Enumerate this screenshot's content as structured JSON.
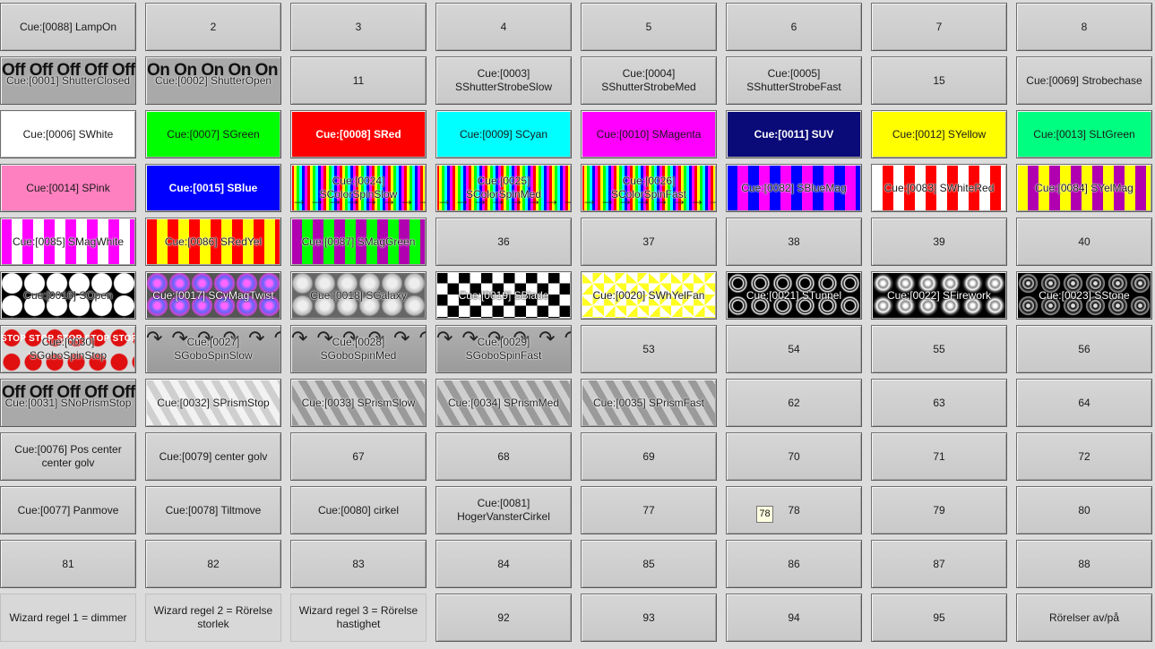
{
  "grid": {
    "rows": 12,
    "cols": 8,
    "buttons": [
      {
        "label": "Cue:[0088] LampOn",
        "style": "plain"
      },
      {
        "label": "2",
        "style": "plain"
      },
      {
        "label": "3",
        "style": "plain"
      },
      {
        "label": "4",
        "style": "plain"
      },
      {
        "label": "5",
        "style": "plain"
      },
      {
        "label": "6",
        "style": "plain"
      },
      {
        "label": "7",
        "style": "plain"
      },
      {
        "label": "8",
        "style": "plain"
      },
      {
        "label": "Cue:[0001] ShutterClosed",
        "style": "offon",
        "overlay": "Off Off Off Off Off",
        "bg": "#a9a9a9"
      },
      {
        "label": "Cue:[0002] ShutterOpen",
        "style": "offon",
        "overlay": "On On On On On",
        "bg": "#a9a9a9"
      },
      {
        "label": "11",
        "style": "plain"
      },
      {
        "label": "Cue:[0003]\nSShutterStrobeSlow",
        "style": "plain"
      },
      {
        "label": "Cue:[0004]\nSShutterStrobeMed",
        "style": "plain"
      },
      {
        "label": "Cue:[0005]\nSShutterStrobeFast",
        "style": "plain"
      },
      {
        "label": "15",
        "style": "plain"
      },
      {
        "label": "Cue:[0069] Strobechase",
        "style": "plain"
      },
      {
        "label": "Cue:[0006] SWhite",
        "style": "solid",
        "bg": "#ffffff"
      },
      {
        "label": "Cue:[0007] SGreen",
        "style": "solid",
        "bg": "#00ff00"
      },
      {
        "label": "Cue:[0008] SRed",
        "style": "solid",
        "bg": "#ff0000",
        "text": "light"
      },
      {
        "label": "Cue:[0009] SCyan",
        "style": "solid",
        "bg": "#00ffff"
      },
      {
        "label": "Cue:[0010] SMagenta",
        "style": "solid",
        "bg": "#ff00ff"
      },
      {
        "label": "Cue:[0011] SUV",
        "style": "solid",
        "bg": "#0a0a78",
        "text": "light"
      },
      {
        "label": "Cue:[0012] SYellow",
        "style": "solid",
        "bg": "#ffff00"
      },
      {
        "label": "Cue:[0013] SLtGreen",
        "style": "solid",
        "bg": "#00ff80"
      },
      {
        "label": "Cue:[0014] SPink",
        "style": "solid",
        "bg": "#ff80c0"
      },
      {
        "label": "Cue:[0015] SBlue",
        "style": "solid",
        "bg": "#0000ff",
        "text": "light"
      },
      {
        "label": "Cue:[0024] SColorSpinSlow",
        "style": "rainbow"
      },
      {
        "label": "Cue:[0025] SColorSpinMed",
        "style": "rainbow"
      },
      {
        "label": "Cue:[0026] SColorSpinFast",
        "style": "rainbow"
      },
      {
        "label": "Cue:[0082] SBlueMag",
        "style": "stripes",
        "c1": "#0000ff",
        "c2": "#ff00ff"
      },
      {
        "label": "Cue:[0083] SWhiteRed",
        "style": "stripes",
        "c1": "#ffffff",
        "c2": "#ff0000"
      },
      {
        "label": "Cue:[0084] SYelMag",
        "style": "stripes",
        "c1": "#ffff00",
        "c2": "#b000b0"
      },
      {
        "label": "Cue:[0085] SMagWhite",
        "style": "stripes",
        "c1": "#ff00ff",
        "c2": "#ffffff"
      },
      {
        "label": "Cue:[0086] SRedYel",
        "style": "stripes",
        "c1": "#ff0000",
        "c2": "#ffff00"
      },
      {
        "label": "Cue:[0087] SMagGreen",
        "style": "stripes",
        "c1": "#b000b0",
        "c2": "#00ff00"
      },
      {
        "label": "36",
        "style": "plain"
      },
      {
        "label": "37",
        "style": "plain"
      },
      {
        "label": "38",
        "style": "plain"
      },
      {
        "label": "39",
        "style": "plain"
      },
      {
        "label": "40",
        "style": "plain"
      },
      {
        "label": "Cue:[0016] SOpen",
        "style": "gobo",
        "gobo": "open"
      },
      {
        "label": "Cue:[0017] SCyMagTwist",
        "style": "gobo",
        "gobo": "twist"
      },
      {
        "label": "Cue:[0018] SGalaxy",
        "style": "gobo",
        "gobo": "galaxy"
      },
      {
        "label": "Cue:[0019] SBlade",
        "style": "gobo",
        "gobo": "blade"
      },
      {
        "label": "Cue:[0020] SWhYelFan",
        "style": "gobo",
        "gobo": "fan"
      },
      {
        "label": "Cue:[0021] STunnel",
        "style": "gobo",
        "gobo": "tunnel"
      },
      {
        "label": "Cue:[0022] SFirework",
        "style": "gobo",
        "gobo": "firework"
      },
      {
        "label": "Cue:[0023] SStone",
        "style": "gobo",
        "gobo": "stone"
      },
      {
        "label": "Cue:[0030] SGoboSpinStop",
        "style": "stop",
        "overlay": "STOP STOP STOP STOP STOP STOP"
      },
      {
        "label": "Cue:[0027] SGoboSpinSlow",
        "style": "spin"
      },
      {
        "label": "Cue:[0028] SGoboSpinMed",
        "style": "spin"
      },
      {
        "label": "Cue:[0029] SGoboSpinFast",
        "style": "spin"
      },
      {
        "label": "53",
        "style": "plain"
      },
      {
        "label": "54",
        "style": "plain"
      },
      {
        "label": "55",
        "style": "plain"
      },
      {
        "label": "56",
        "style": "plain"
      },
      {
        "label": "Cue:[0031] SNoPrismStop",
        "style": "offon",
        "overlay": "Off Off Off Off Off",
        "bg": "#a9a9a9"
      },
      {
        "label": "Cue:[0032] SPrismStop",
        "style": "prism",
        "bg": "#f2f2f2"
      },
      {
        "label": "Cue:[0033] SPrismSlow",
        "style": "prism",
        "bg": "#9a9a9a"
      },
      {
        "label": "Cue:[0034] SPrismMed",
        "style": "prism",
        "bg": "#9a9a9a"
      },
      {
        "label": "Cue:[0035] SPrismFast",
        "style": "prism",
        "bg": "#9a9a9a"
      },
      {
        "label": "62",
        "style": "plain"
      },
      {
        "label": "63",
        "style": "plain"
      },
      {
        "label": "64",
        "style": "plain"
      },
      {
        "label": "Cue:[0076] Pos center\ncenter golv",
        "style": "plain"
      },
      {
        "label": "Cue:[0079] center golv",
        "style": "plain"
      },
      {
        "label": "67",
        "style": "plain"
      },
      {
        "label": "68",
        "style": "plain"
      },
      {
        "label": "69",
        "style": "plain"
      },
      {
        "label": "70",
        "style": "plain"
      },
      {
        "label": "71",
        "style": "plain"
      },
      {
        "label": "72",
        "style": "plain"
      },
      {
        "label": "Cue:[0077] Panmove",
        "style": "plain"
      },
      {
        "label": "Cue:[0078] Tiltmove",
        "style": "plain"
      },
      {
        "label": "Cue:[0080] cirkel",
        "style": "plain"
      },
      {
        "label": "Cue:[0081]\nHogerVansterCirkel",
        "style": "plain"
      },
      {
        "label": "77",
        "style": "plain"
      },
      {
        "label": "78",
        "style": "plain"
      },
      {
        "label": "79",
        "style": "plain"
      },
      {
        "label": "80",
        "style": "plain"
      },
      {
        "label": "81",
        "style": "plain"
      },
      {
        "label": "82",
        "style": "plain"
      },
      {
        "label": "83",
        "style": "plain"
      },
      {
        "label": "84",
        "style": "plain"
      },
      {
        "label": "85",
        "style": "plain"
      },
      {
        "label": "86",
        "style": "plain"
      },
      {
        "label": "87",
        "style": "plain"
      },
      {
        "label": "88",
        "style": "plain"
      },
      {
        "label": "Wizard regel 1 = dimmer",
        "style": "flat"
      },
      {
        "label": "Wizard regel 2 = Rörelse\nstorlek",
        "style": "flat"
      },
      {
        "label": "Wizard regel 3 = Rörelse\nhastighet",
        "style": "flat"
      },
      {
        "label": "92",
        "style": "plain"
      },
      {
        "label": "93",
        "style": "plain"
      },
      {
        "label": "94",
        "style": "plain"
      },
      {
        "label": "95",
        "style": "plain"
      },
      {
        "label": "Rörelser av/på",
        "style": "plain"
      }
    ]
  },
  "tooltip": {
    "text": "78"
  }
}
